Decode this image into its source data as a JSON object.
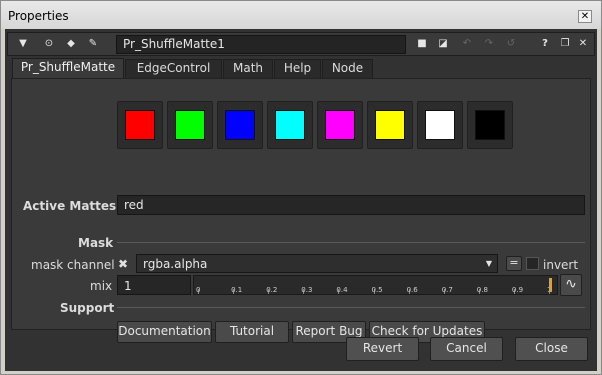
{
  "window": {
    "title": "Properties",
    "close_glyph": "✕"
  },
  "toolbar": {
    "node_name": "Pr_ShuffleMatte1"
  },
  "tabs": [
    "Pr_ShuffleMatte",
    "EdgeControl",
    "Math",
    "Help",
    "Node"
  ],
  "swatches": [
    {
      "name": "red",
      "color": "#ff0000"
    },
    {
      "name": "green",
      "color": "#00ff00"
    },
    {
      "name": "blue",
      "color": "#0000ff"
    },
    {
      "name": "cyan",
      "color": "#00ffff"
    },
    {
      "name": "magenta",
      "color": "#ff00ff"
    },
    {
      "name": "yellow",
      "color": "#ffff00"
    },
    {
      "name": "white",
      "color": "#ffffff"
    },
    {
      "name": "black",
      "color": "#000000"
    }
  ],
  "active_mattes": {
    "label": "Active Mattes",
    "value": "red"
  },
  "mask": {
    "section_label": "Mask",
    "channel_label": "mask channel",
    "channel_value": "rgba.alpha",
    "invert_label": "invert",
    "invert_checked": false,
    "mix_label": "mix",
    "mix_value": "1",
    "slider_ticks": [
      "0",
      "0.1",
      "0.2",
      "0.3",
      "0.4",
      "0.5",
      "0.6",
      "0.7",
      "0.8",
      "0.9",
      "1"
    ],
    "mix_fraction": 1.0
  },
  "support": {
    "section_label": "Support",
    "buttons": [
      "Documentation",
      "Tutorial",
      "Report Bug",
      "Check for Updates"
    ]
  },
  "footer": {
    "revert": "Revert",
    "cancel": "Cancel",
    "close": "Close"
  }
}
